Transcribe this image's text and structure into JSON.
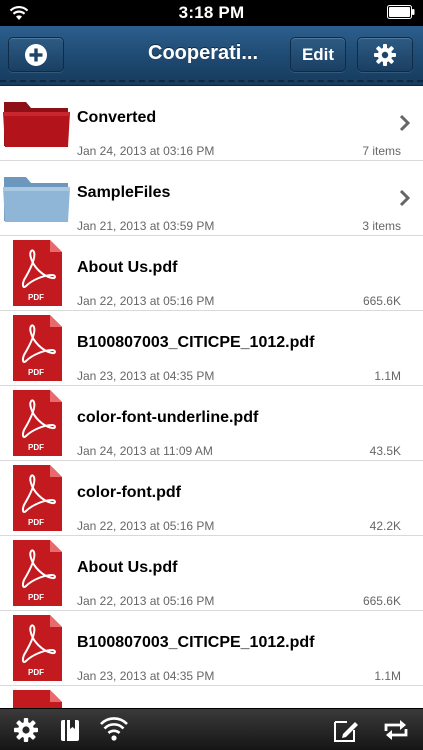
{
  "status_bar": {
    "time": "3:18 PM"
  },
  "nav": {
    "title": "Cooperati...",
    "edit_label": "Edit"
  },
  "files": [
    {
      "name": "Converted",
      "date": "Jan 24, 2013 at 03:16 PM",
      "meta": "7 items",
      "kind": "folder-red"
    },
    {
      "name": "SampleFiles",
      "date": "Jan 21, 2013 at 03:59 PM",
      "meta": "3 items",
      "kind": "folder-blue"
    },
    {
      "name": "About Us.pdf",
      "date": "Jan 22, 2013 at 05:16 PM",
      "meta": "665.6K",
      "kind": "pdf"
    },
    {
      "name": "B100807003_CITICPE_1012.pdf",
      "date": "Jan 23, 2013 at 04:35 PM",
      "meta": "1.1M",
      "kind": "pdf"
    },
    {
      "name": "color-font-underline.pdf",
      "date": "Jan 24, 2013 at 11:09 AM",
      "meta": "43.5K",
      "kind": "pdf"
    },
    {
      "name": "color-font.pdf",
      "date": "Jan 22, 2013 at 05:16 PM",
      "meta": "42.2K",
      "kind": "pdf"
    },
    {
      "name": "About Us.pdf",
      "date": "Jan 22, 2013 at 05:16 PM",
      "meta": "665.6K",
      "kind": "pdf"
    },
    {
      "name": "B100807003_CITICPE_1012.pdf",
      "date": "Jan 23, 2013 at 04:35 PM",
      "meta": "1.1M",
      "kind": "pdf"
    }
  ],
  "pdf_badge": "PDF",
  "icons": {
    "add": "plus-circle-icon",
    "settings": "gear-icon",
    "toolbar": [
      "gear-icon",
      "bookmarks-icon",
      "wifi-icon",
      "compose-icon",
      "sync-icon"
    ]
  },
  "colors": {
    "nav_bar": "#1f4b73",
    "folder_red": "#b3141c",
    "folder_blue": "#8fb6d6",
    "pdf_red": "#c21a1f"
  }
}
